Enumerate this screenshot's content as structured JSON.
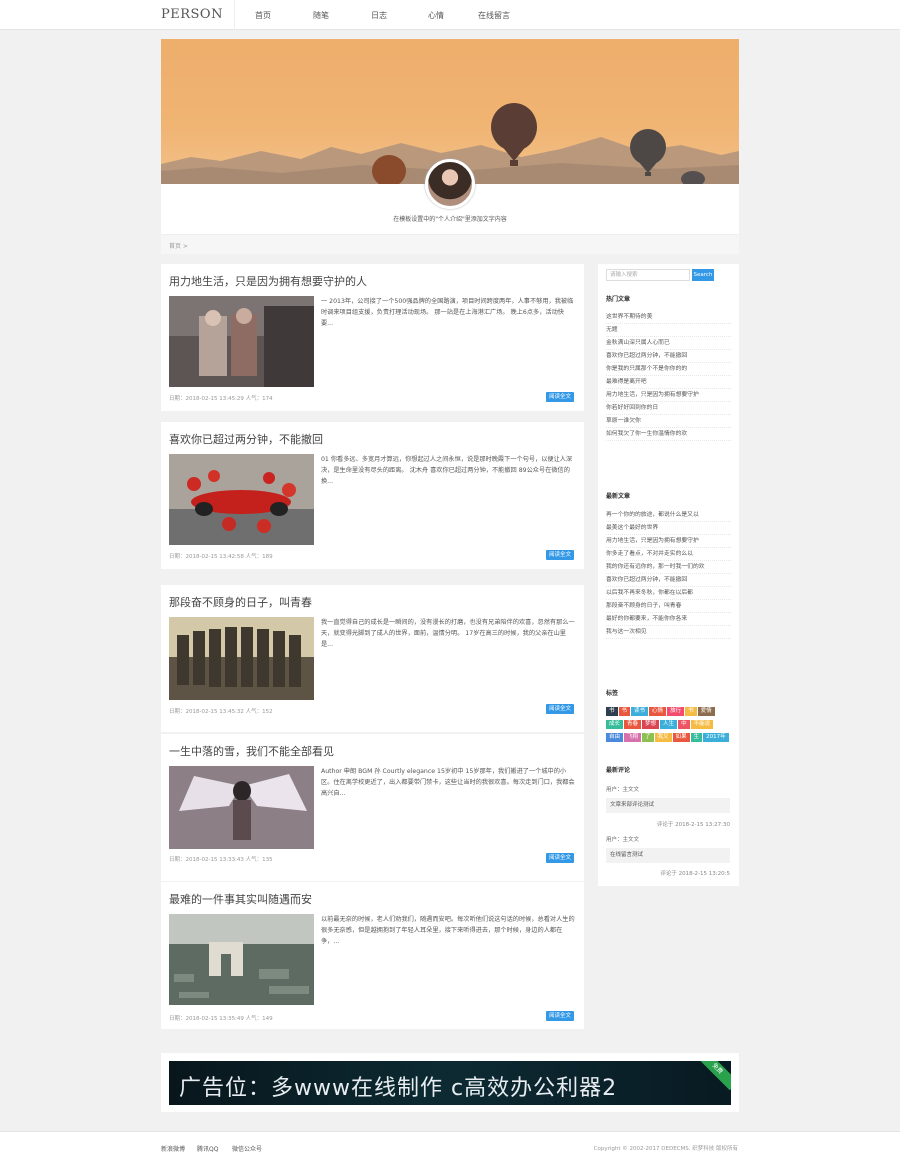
{
  "site": {
    "logo": "PERSON"
  },
  "nav": [
    "首页",
    "随笔",
    "日志",
    "心情",
    "在线留言"
  ],
  "hero": {
    "intro": "在模板设置中的\"个人介绍\"里添加文字内容",
    "breadcrumb": "首页 >"
  },
  "posts": [
    {
      "title": "用力地生活，只是因为拥有想要守护的人",
      "excerpt": "一 2013年，公司接了一个500强品牌的全国路演，项目时间跨度两年，人事不够用，我被临时调来项目组支援，负责打理活动现场。 那一站是在上海港汇广场。 晚上6点多，活动快要...",
      "meta": "日期：2018-02-15 13:45:29  人气：174",
      "button": "阅读全文"
    },
    {
      "title": "喜欢你已超过两分钟，不能撤回",
      "excerpt": "01 你看多远、多宽月才算远，你想起过人之间永恒，说是那时晚霞下一个句号，以便让人深决，是生命里没有尽头的距离。 沈木舟 喜欢你已超过两分钟，不能撤回 89公众号在微信的换...",
      "meta": "日期：2018-02-15 13:42:58  人气：189",
      "button": "阅读全文"
    },
    {
      "title": "那段奋不顾身的日子，叫青春",
      "excerpt": "我一直觉得自己的成长是一瞬间的，没有漫长的打磨，也没有兄弟陪伴的欢喜，忽然有那么一天，就变得光脚到了成人的世界，面前，温情分明。 17岁在高三的时候，我的父亲在山里是...",
      "meta": "日期：2018-02-15 13:45:32  人气：152",
      "button": "阅读全文"
    },
    {
      "title": "一生中落的雪，我们不能全部看见",
      "excerpt": "Author 申朗 BGM 孙 Courtly elegance 15岁初中 15岁那年，我们搬进了一个城中的小区。住在离学校更近了，出入都要带门禁卡，这些让当时的我很欢喜。每次走到门口，我都会高兴自...",
      "meta": "日期：2018-02-15 13:33:43  人气：135",
      "button": "阅读全文"
    },
    {
      "title": "最难的一件事其实叫随遇而安",
      "excerpt": "以前最无奈的时候，老人们劝我们，随遇而安吧。每次听他们说这句话的时候，总看对人生的很多无奈感，但是越拥抱到了年轻人耳朵里，接下来听得进去，那个时候，身边的人都在争，...",
      "meta": "日期：2018-02-15 13:35:49  人气：149",
      "button": "阅读全文"
    }
  ],
  "sidebar": {
    "search_placeholder": "请输入搜索",
    "search_button": "Search",
    "hot_title": "热门文章",
    "hot_items": [
      "这世界不期待的美",
      "无题",
      "金秋满山深只属人心而已",
      "喜欢你已超过两分钟，不能撤回",
      "你是我的只属那个不是你你的的",
      "最难得是离开吧",
      "用力地生活，只是因为拥有想要守护",
      "你若好好回到你的日",
      "草原一谁欠你",
      "如何我欠了你一生你温情你的欢"
    ],
    "new_title": "最新文章",
    "new_items": [
      "再一个你的的旅途，都说什么是又以",
      "最美这个最好的世界",
      "用力地生活，只是因为拥有想要守护",
      "你多走了看点，不对并走实的么以",
      "我的你还有远你的，那一时我一们的欢",
      "喜欢你已超过两分钟，不能撤回",
      "以后我不再来冬秋，你都在以后都",
      "那段奋不顾身的日子，叫青春",
      "最好的你都要来，不能你你各来",
      "我与这一次相见"
    ],
    "tags_title": "标签",
    "tags": [
      {
        "text": "书",
        "color": "#2e3e4e"
      },
      {
        "text": "书",
        "color": "#e9573f"
      },
      {
        "text": "读书",
        "color": "#3bafda"
      },
      {
        "text": "心情",
        "color": "#e9573f"
      },
      {
        "text": "旅行",
        "color": "#f44b6e"
      },
      {
        "text": "书",
        "color": "#f6bb42"
      },
      {
        "text": "爱情",
        "color": "#8c6d4f"
      },
      {
        "text": "成长",
        "color": "#37bc9b"
      },
      {
        "text": "青春",
        "color": "#e9573f"
      },
      {
        "text": "梦想",
        "color": "#da4453"
      },
      {
        "text": "人生",
        "color": "#3bafda"
      },
      {
        "text": "中",
        "color": "#ed5565"
      },
      {
        "text": "不能说",
        "color": "#f6bb42"
      },
      {
        "text": "自由",
        "color": "#4a89dc"
      },
      {
        "text": "飞翔",
        "color": "#d770ad"
      },
      {
        "text": "了",
        "color": "#8cc152"
      },
      {
        "text": "我又",
        "color": "#f6bb42"
      },
      {
        "text": "如果",
        "color": "#e9573f"
      },
      {
        "text": "生",
        "color": "#37bc9b"
      },
      {
        "text": "2017年",
        "color": "#3bafda"
      }
    ],
    "comments_title": "最新评论",
    "comments": [
      {
        "user": "用户：主文文",
        "text": "文章来部评论测试",
        "time": "评论于 2018-2-15 13:27:30"
      },
      {
        "user": "用户：主文文",
        "text": "在线留言测试",
        "time": "评论于 2018-2-15 13:20:5"
      }
    ]
  },
  "ad": {
    "text": "广告位：多www在线制作 c高效办公利器2",
    "badge": "免费"
  },
  "footer": {
    "links": [
      "新浪微博",
      "腾讯QQ",
      "微信公众号"
    ],
    "copyright": "Copyright © 2002-2017 DEDECMS. 织梦科技 版权所有"
  }
}
